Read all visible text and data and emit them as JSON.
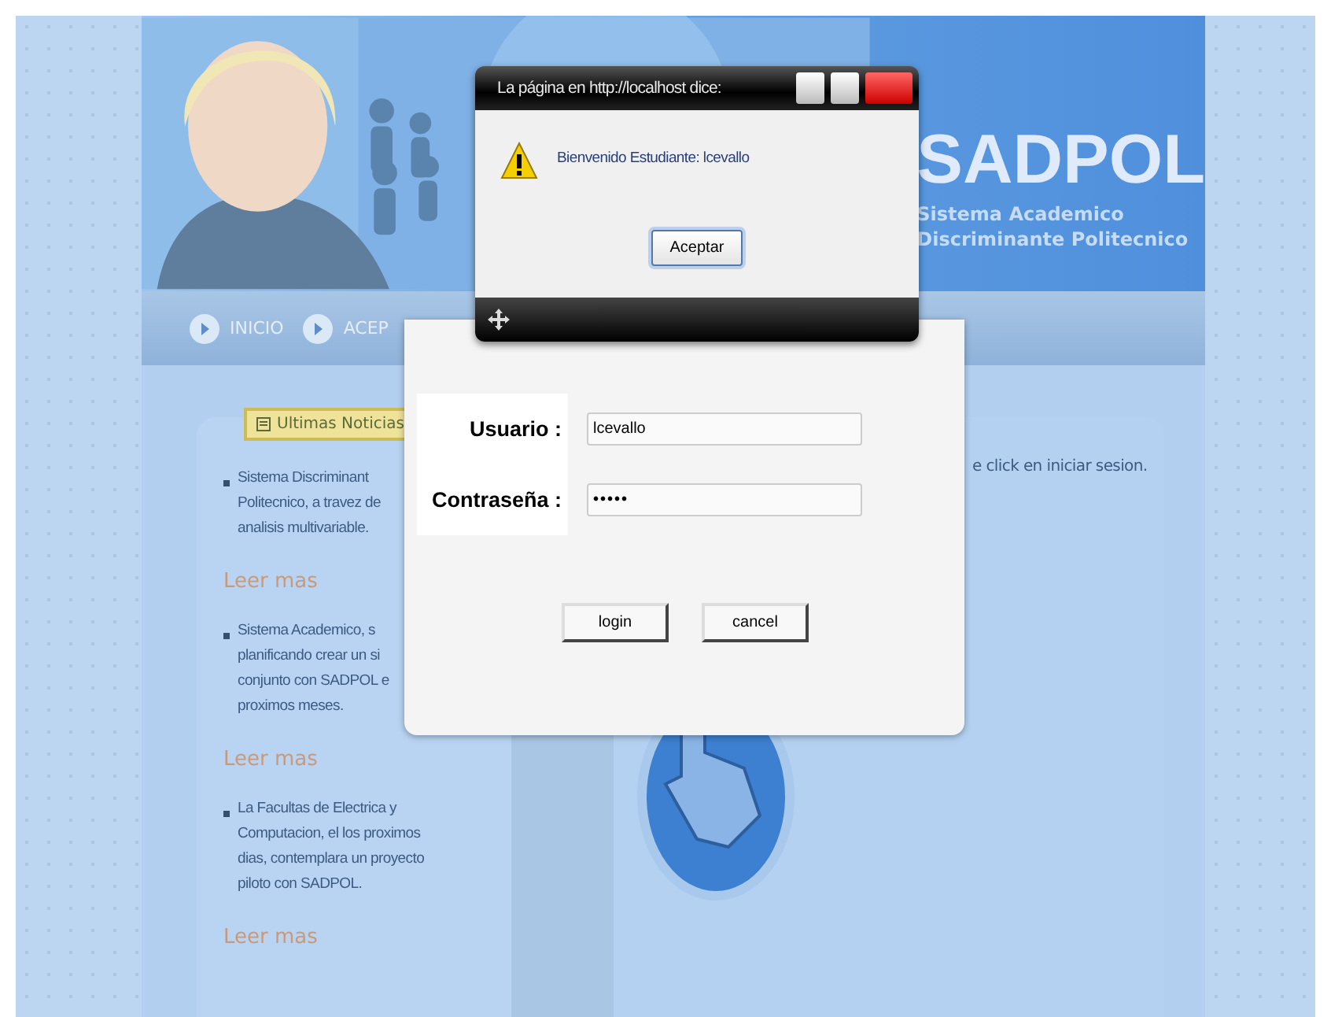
{
  "header": {
    "title": "SADPOL",
    "subtitle_lines": [
      "Sistema Academico",
      "Discriminante Politecnico"
    ]
  },
  "nav": [
    {
      "label": "INICIO"
    },
    {
      "label": "ACEP"
    }
  ],
  "news": {
    "tab": "Ultimas Noticias",
    "items": [
      {
        "lines": [
          "Sistema Discriminant",
          "Politecnico, a travez de",
          "analisis multivariable."
        ],
        "link": "Leer mas"
      },
      {
        "lines": [
          "Sistema Academico, s",
          "planificando crear un si",
          "conjunto con SADPOL e",
          "proximos meses."
        ],
        "link": "Leer mas"
      },
      {
        "lines": [
          "La Facultas de Electrica y",
          "Computacion, el los proximos",
          "dias, contemplara un proyecto",
          "piloto con SADPOL."
        ],
        "link": "Leer mas"
      }
    ]
  },
  "right_text": "e click en iniciar sesion.",
  "alert": {
    "title": "La página en http://localhost dice:",
    "message": "Bienvenido Estudiante: lcevallo",
    "button": "Aceptar"
  },
  "login": {
    "fields": [
      {
        "label": "Usuario :",
        "value": "lcevallo",
        "kind": "text"
      },
      {
        "label": "Contraseña :",
        "value": "•••••",
        "kind": "password"
      }
    ],
    "buttons": [
      "login",
      "cancel"
    ]
  }
}
